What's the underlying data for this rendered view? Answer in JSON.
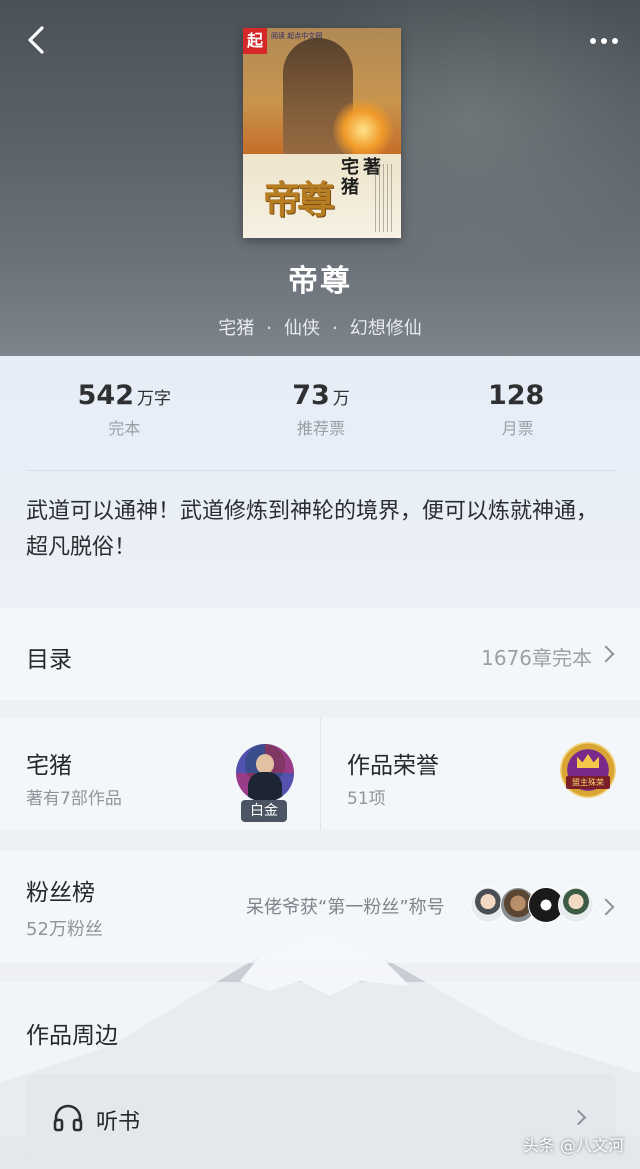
{
  "header": {
    "back_icon": "back-arrow-icon",
    "more_icon": "more-dots-icon"
  },
  "book": {
    "cover": {
      "badge": "起",
      "imprint": "阅读 起点中文网",
      "title_art": "帝尊",
      "author_art_1": "宅猪",
      "author_art_2": "著"
    },
    "title": "帝尊",
    "author": "宅猪",
    "category": "仙侠",
    "subcategory": "幻想修仙",
    "separator": "·"
  },
  "stats": [
    {
      "num": "542",
      "unit": "万字",
      "label": "完本"
    },
    {
      "num": "73",
      "unit": "万",
      "label": "推荐票"
    },
    {
      "num": "128",
      "unit": "",
      "label": "月票"
    }
  ],
  "intro": "武道可以通神！武道修炼到神轮的境界，便可以炼就神通，超凡脱俗！",
  "toc": {
    "label": "目录",
    "meta": "1676章完本"
  },
  "author_card": {
    "name": "宅猪",
    "works": "著有7部作品",
    "badge": "白金"
  },
  "honor_card": {
    "title": "作品荣誉",
    "count": "51项",
    "icon_text": "盟主殊荣"
  },
  "fans": {
    "title": "粉丝榜",
    "count": "52万粉丝",
    "note": "呆佬爷获“第一粉丝”称号"
  },
  "peripherals": {
    "title": "作品周边",
    "listen_label": "听书",
    "listen_icon": "headphones-icon"
  },
  "watermark": "头条 @八文河",
  "colors": {
    "hero_top": "#4b5257",
    "text_primary": "#26282b",
    "text_secondary": "#9aa0a6"
  }
}
